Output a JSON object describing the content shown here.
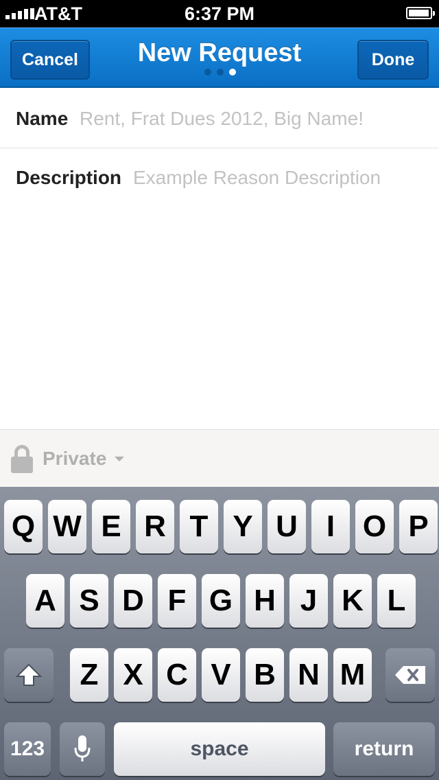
{
  "status_bar": {
    "carrier": "AT&T",
    "time": "6:37 PM",
    "signal_icon": "signal-bars-icon",
    "battery_icon": "battery-icon",
    "battery_level": 0.95
  },
  "nav": {
    "cancel_label": "Cancel",
    "title": "New Request",
    "done_label": "Done",
    "page_count": 3,
    "current_page": 3,
    "accent_color": "#0b74c8"
  },
  "form": {
    "name": {
      "label": "Name",
      "value": "",
      "placeholder": "Rent, Frat Dues 2012, Big Name!"
    },
    "description": {
      "label": "Description",
      "value": "",
      "placeholder": "Example Reason Description"
    }
  },
  "privacy": {
    "lock_icon": "lock-icon",
    "label": "Private",
    "dropdown_icon": "caret-down-icon"
  },
  "keyboard": {
    "row1": [
      "Q",
      "W",
      "E",
      "R",
      "T",
      "Y",
      "U",
      "I",
      "O",
      "P"
    ],
    "row2": [
      "A",
      "S",
      "D",
      "F",
      "G",
      "H",
      "J",
      "K",
      "L"
    ],
    "row3": [
      "Z",
      "X",
      "C",
      "V",
      "B",
      "N",
      "M"
    ],
    "shift_icon": "shift-arrow-icon",
    "delete_icon": "backspace-icon",
    "numbers_label": "123",
    "mic_icon": "microphone-icon",
    "space_label": "space",
    "return_label": "return"
  }
}
